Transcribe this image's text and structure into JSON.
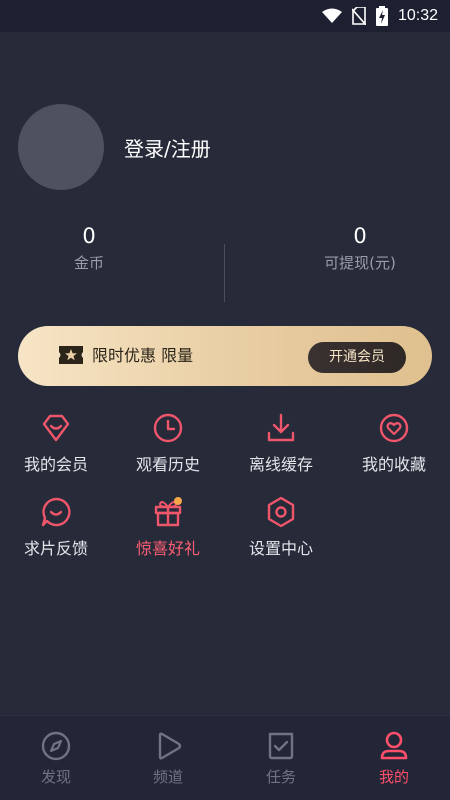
{
  "status_bar": {
    "time": "10:32"
  },
  "profile": {
    "login_label": "登录/注册"
  },
  "stats": {
    "coins": {
      "value": "0",
      "label": "金币"
    },
    "withdrawable": {
      "value": "0",
      "label": "可提现(元)"
    }
  },
  "vip": {
    "promo_text": "限时优惠 限量",
    "button_label": "开通会员"
  },
  "menu": [
    {
      "label": "我的会员",
      "icon": "diamond-icon"
    },
    {
      "label": "观看历史",
      "icon": "clock-icon"
    },
    {
      "label": "离线缓存",
      "icon": "download-icon"
    },
    {
      "label": "我的收藏",
      "icon": "heart-icon"
    },
    {
      "label": "求片反馈",
      "icon": "chat-bubble-icon"
    },
    {
      "label": "惊喜好礼",
      "icon": "gift-icon"
    },
    {
      "label": "设置中心",
      "icon": "settings-hexagon-icon"
    }
  ],
  "tabs": [
    {
      "label": "发现",
      "icon": "compass-icon"
    },
    {
      "label": "频道",
      "icon": "play-icon"
    },
    {
      "label": "任务",
      "icon": "task-check-icon"
    },
    {
      "label": "我的",
      "icon": "user-icon",
      "active": true
    }
  ],
  "colors": {
    "background": "#262a39",
    "accent": "#ff4f6a",
    "icon_red": "#f0566b",
    "vip_gold": "#e9cfa5"
  }
}
